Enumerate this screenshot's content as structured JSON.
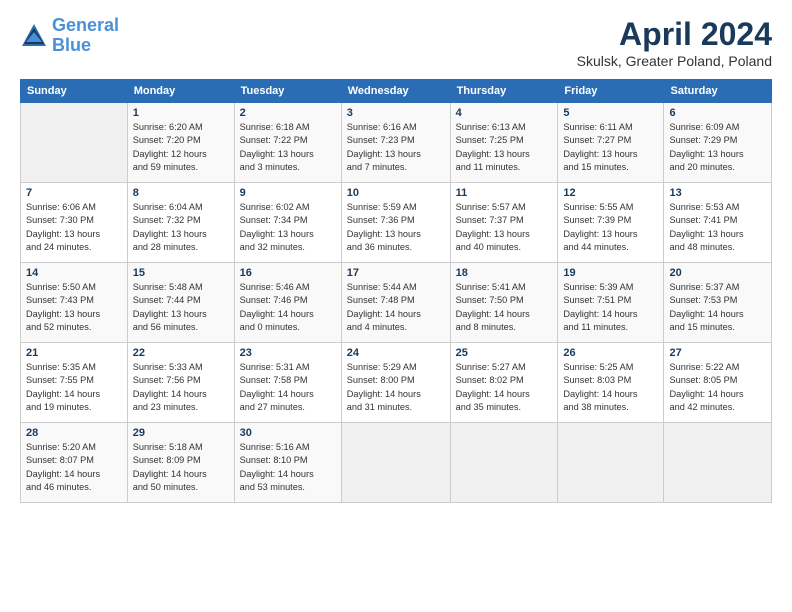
{
  "header": {
    "logo_line1": "General",
    "logo_line2": "Blue",
    "title": "April 2024",
    "subtitle": "Skulsk, Greater Poland, Poland"
  },
  "days_of_week": [
    "Sunday",
    "Monday",
    "Tuesday",
    "Wednesday",
    "Thursday",
    "Friday",
    "Saturday"
  ],
  "weeks": [
    [
      {
        "day": "",
        "info": ""
      },
      {
        "day": "1",
        "info": "Sunrise: 6:20 AM\nSunset: 7:20 PM\nDaylight: 12 hours\nand 59 minutes."
      },
      {
        "day": "2",
        "info": "Sunrise: 6:18 AM\nSunset: 7:22 PM\nDaylight: 13 hours\nand 3 minutes."
      },
      {
        "day": "3",
        "info": "Sunrise: 6:16 AM\nSunset: 7:23 PM\nDaylight: 13 hours\nand 7 minutes."
      },
      {
        "day": "4",
        "info": "Sunrise: 6:13 AM\nSunset: 7:25 PM\nDaylight: 13 hours\nand 11 minutes."
      },
      {
        "day": "5",
        "info": "Sunrise: 6:11 AM\nSunset: 7:27 PM\nDaylight: 13 hours\nand 15 minutes."
      },
      {
        "day": "6",
        "info": "Sunrise: 6:09 AM\nSunset: 7:29 PM\nDaylight: 13 hours\nand 20 minutes."
      }
    ],
    [
      {
        "day": "7",
        "info": "Sunrise: 6:06 AM\nSunset: 7:30 PM\nDaylight: 13 hours\nand 24 minutes."
      },
      {
        "day": "8",
        "info": "Sunrise: 6:04 AM\nSunset: 7:32 PM\nDaylight: 13 hours\nand 28 minutes."
      },
      {
        "day": "9",
        "info": "Sunrise: 6:02 AM\nSunset: 7:34 PM\nDaylight: 13 hours\nand 32 minutes."
      },
      {
        "day": "10",
        "info": "Sunrise: 5:59 AM\nSunset: 7:36 PM\nDaylight: 13 hours\nand 36 minutes."
      },
      {
        "day": "11",
        "info": "Sunrise: 5:57 AM\nSunset: 7:37 PM\nDaylight: 13 hours\nand 40 minutes."
      },
      {
        "day": "12",
        "info": "Sunrise: 5:55 AM\nSunset: 7:39 PM\nDaylight: 13 hours\nand 44 minutes."
      },
      {
        "day": "13",
        "info": "Sunrise: 5:53 AM\nSunset: 7:41 PM\nDaylight: 13 hours\nand 48 minutes."
      }
    ],
    [
      {
        "day": "14",
        "info": "Sunrise: 5:50 AM\nSunset: 7:43 PM\nDaylight: 13 hours\nand 52 minutes."
      },
      {
        "day": "15",
        "info": "Sunrise: 5:48 AM\nSunset: 7:44 PM\nDaylight: 13 hours\nand 56 minutes."
      },
      {
        "day": "16",
        "info": "Sunrise: 5:46 AM\nSunset: 7:46 PM\nDaylight: 14 hours\nand 0 minutes."
      },
      {
        "day": "17",
        "info": "Sunrise: 5:44 AM\nSunset: 7:48 PM\nDaylight: 14 hours\nand 4 minutes."
      },
      {
        "day": "18",
        "info": "Sunrise: 5:41 AM\nSunset: 7:50 PM\nDaylight: 14 hours\nand 8 minutes."
      },
      {
        "day": "19",
        "info": "Sunrise: 5:39 AM\nSunset: 7:51 PM\nDaylight: 14 hours\nand 11 minutes."
      },
      {
        "day": "20",
        "info": "Sunrise: 5:37 AM\nSunset: 7:53 PM\nDaylight: 14 hours\nand 15 minutes."
      }
    ],
    [
      {
        "day": "21",
        "info": "Sunrise: 5:35 AM\nSunset: 7:55 PM\nDaylight: 14 hours\nand 19 minutes."
      },
      {
        "day": "22",
        "info": "Sunrise: 5:33 AM\nSunset: 7:56 PM\nDaylight: 14 hours\nand 23 minutes."
      },
      {
        "day": "23",
        "info": "Sunrise: 5:31 AM\nSunset: 7:58 PM\nDaylight: 14 hours\nand 27 minutes."
      },
      {
        "day": "24",
        "info": "Sunrise: 5:29 AM\nSunset: 8:00 PM\nDaylight: 14 hours\nand 31 minutes."
      },
      {
        "day": "25",
        "info": "Sunrise: 5:27 AM\nSunset: 8:02 PM\nDaylight: 14 hours\nand 35 minutes."
      },
      {
        "day": "26",
        "info": "Sunrise: 5:25 AM\nSunset: 8:03 PM\nDaylight: 14 hours\nand 38 minutes."
      },
      {
        "day": "27",
        "info": "Sunrise: 5:22 AM\nSunset: 8:05 PM\nDaylight: 14 hours\nand 42 minutes."
      }
    ],
    [
      {
        "day": "28",
        "info": "Sunrise: 5:20 AM\nSunset: 8:07 PM\nDaylight: 14 hours\nand 46 minutes."
      },
      {
        "day": "29",
        "info": "Sunrise: 5:18 AM\nSunset: 8:09 PM\nDaylight: 14 hours\nand 50 minutes."
      },
      {
        "day": "30",
        "info": "Sunrise: 5:16 AM\nSunset: 8:10 PM\nDaylight: 14 hours\nand 53 minutes."
      },
      {
        "day": "",
        "info": ""
      },
      {
        "day": "",
        "info": ""
      },
      {
        "day": "",
        "info": ""
      },
      {
        "day": "",
        "info": ""
      }
    ]
  ]
}
